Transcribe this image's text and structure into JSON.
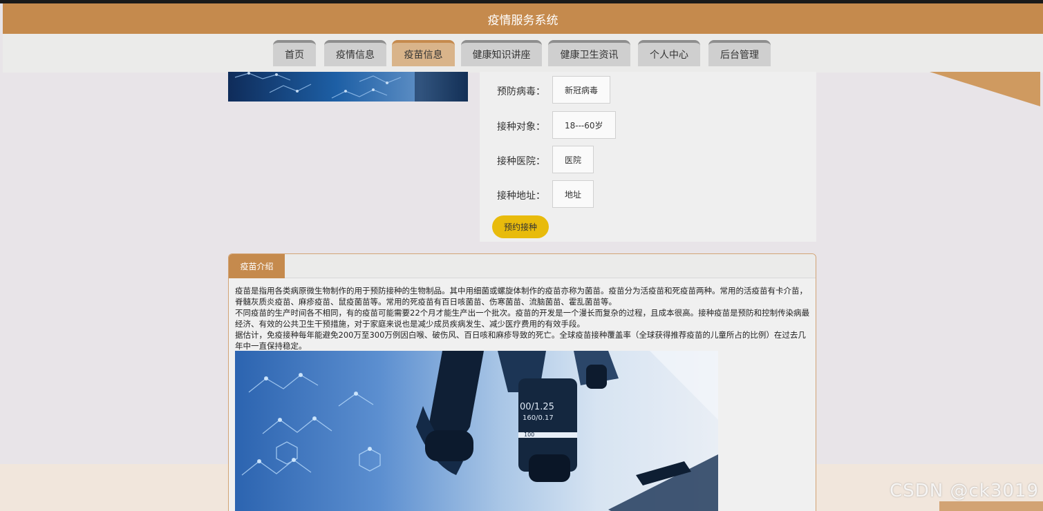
{
  "header": {
    "title": "疫情服务系统"
  },
  "nav": {
    "items": [
      {
        "label": "首页",
        "active": false
      },
      {
        "label": "疫情信息",
        "active": false
      },
      {
        "label": "疫苗信息",
        "active": true
      },
      {
        "label": "健康知识讲座",
        "active": false
      },
      {
        "label": "健康卫生资讯",
        "active": false
      },
      {
        "label": "个人中心",
        "active": false
      },
      {
        "label": "后台管理",
        "active": false
      }
    ]
  },
  "vaccine_info": {
    "rows": [
      {
        "label": "预防病毒：",
        "value": "新冠病毒"
      },
      {
        "label": "接种对象：",
        "value": "18---60岁"
      },
      {
        "label": "接种医院：",
        "value": "医院"
      },
      {
        "label": "接种地址：",
        "value": "地址"
      }
    ],
    "book_button": "预约接种"
  },
  "intro": {
    "tab_label": "疫苗介绍",
    "paragraphs": [
      "疫苗是指用各类病原微生物制作的用于预防接种的生物制品。其中用细菌或螺旋体制作的疫苗亦称为菌苗。疫苗分为活疫苗和死疫苗两种。常用的活疫苗有卡介苗，脊髓灰质炎疫苗、麻疹疫苗、鼠疫菌苗等。常用的死疫苗有百日咳菌苗、伤寒菌苗、流脑菌苗、霍乱菌苗等。",
      "不同疫苗的生产时间各不相同，有的疫苗可能需要22个月才能生产出一个批次。疫苗的开发是一个漫长而复杂的过程，且成本很高。接种疫苗是预防和控制传染病最经济、有效的公共卫生干预措施，对于家庭来说也是减少成员疾病发生、减少医疗费用的有效手段。",
      "据估计，免疫接种每年能避免200万至300万例因白喉、破伤风、百日咳和麻疹导致的死亡。全球疫苗接种覆盖率（全球获得推荐疫苗的儿童所占的比例）在过去几年中一直保持稳定。"
    ]
  },
  "image_texts": {
    "lens_mark_1": "00/1.25",
    "lens_mark_2": "160/0.17",
    "lens_mark_3": "100"
  },
  "watermark": "CSDN @ck3019",
  "colors": {
    "brand": "#c58a4d",
    "button_yellow": "#e8bb0c",
    "nav_active": "#d9b48a"
  }
}
